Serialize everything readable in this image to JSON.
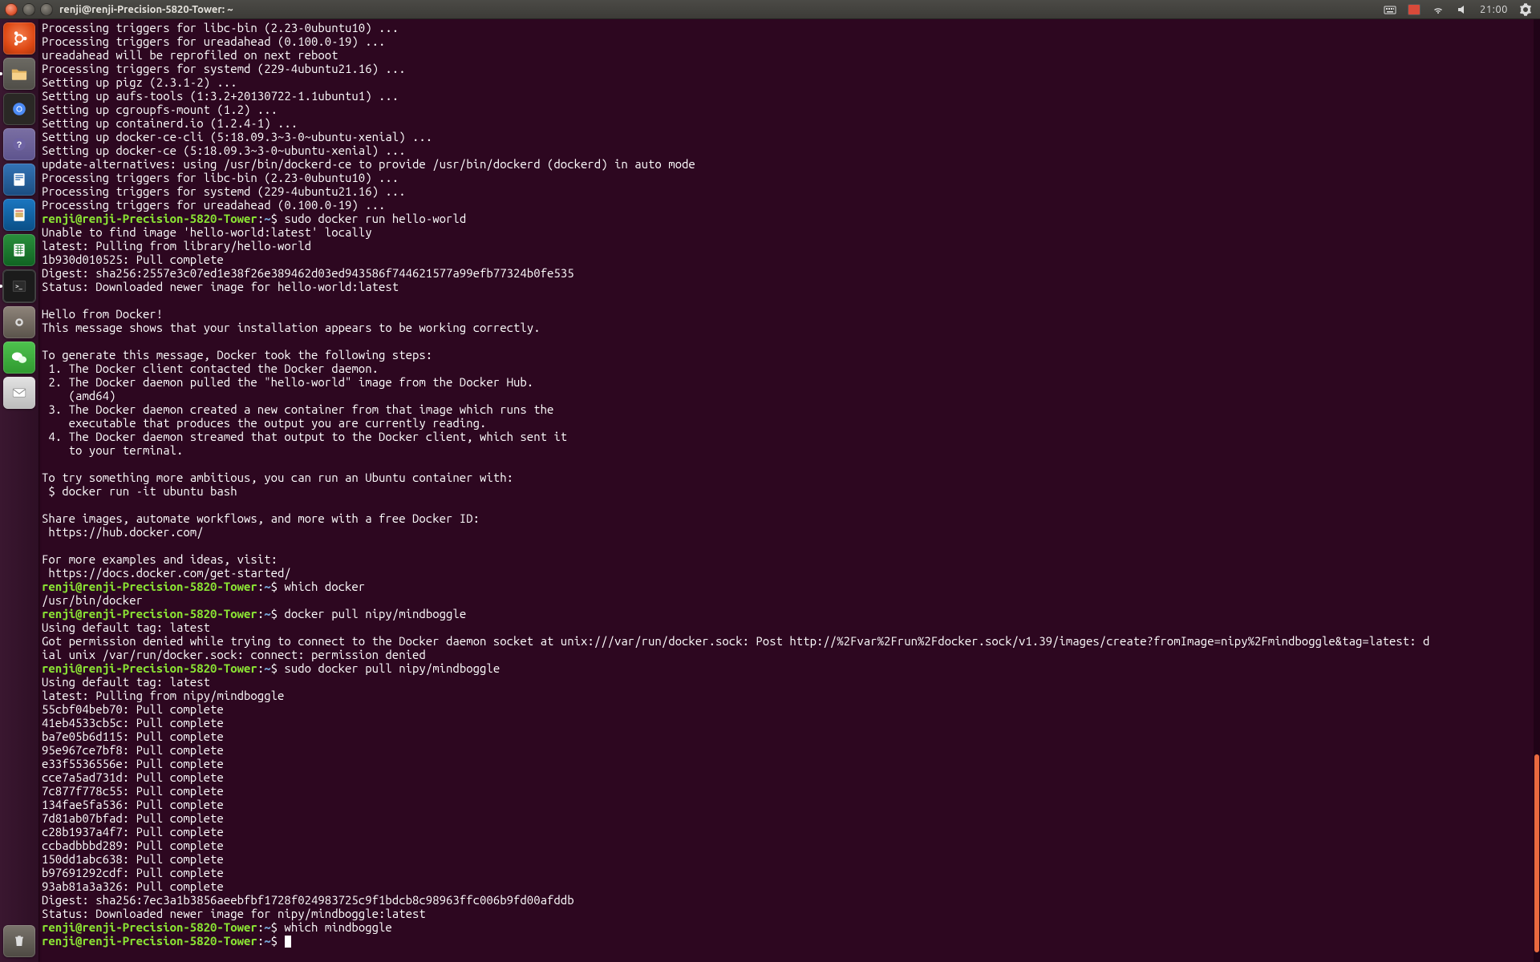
{
  "menubar": {
    "title": "renji@renji-Precision-5820-Tower: ~",
    "clock": "21:00"
  },
  "launcher": {
    "items": [
      {
        "name": "dash",
        "label": ""
      },
      {
        "name": "files",
        "label": ""
      },
      {
        "name": "chromium",
        "label": ""
      },
      {
        "name": "help",
        "label": "?"
      },
      {
        "name": "writer",
        "label": ""
      },
      {
        "name": "impress",
        "label": ""
      },
      {
        "name": "calc",
        "label": ""
      },
      {
        "name": "terminal",
        "label": ">_"
      },
      {
        "name": "settings",
        "label": ""
      },
      {
        "name": "wechat",
        "label": ""
      },
      {
        "name": "mail",
        "label": ""
      }
    ],
    "trash": {
      "name": "trash",
      "label": ""
    }
  },
  "prompt": {
    "user_host": "renji@renji-Precision-5820-Tower",
    "sep1": ":",
    "path": "~",
    "sep2": "$"
  },
  "cmds": {
    "c1": " sudo docker run hello-world",
    "c2": " which docker",
    "c3": " docker pull nipy/mindboggle",
    "c4": " sudo docker pull nipy/mindboggle",
    "c5": " which mindboggle",
    "c6": " "
  },
  "out": {
    "pre1": "Processing triggers for libc-bin (2.23-0ubuntu10) ...\nProcessing triggers for ureadahead (0.100.0-19) ...\nureadahead will be reprofiled on next reboot\nProcessing triggers for systemd (229-4ubuntu21.16) ...\nSetting up pigz (2.3.1-2) ...\nSetting up aufs-tools (1:3.2+20130722-1.1ubuntu1) ...\nSetting up cgroupfs-mount (1.2) ...\nSetting up containerd.io (1.2.4-1) ...\nSetting up docker-ce-cli (5:18.09.3~3-0~ubuntu-xenial) ...\nSetting up docker-ce (5:18.09.3~3-0~ubuntu-xenial) ...\nupdate-alternatives: using /usr/bin/dockerd-ce to provide /usr/bin/dockerd (dockerd) in auto mode\nProcessing triggers for libc-bin (2.23-0ubuntu10) ...\nProcessing triggers for systemd (229-4ubuntu21.16) ...\nProcessing triggers for ureadahead (0.100.0-19) ...",
    "o1": "Unable to find image 'hello-world:latest' locally\nlatest: Pulling from library/hello-world\n1b930d010525: Pull complete\nDigest: sha256:2557e3c07ed1e38f26e389462d03ed943586f744621577a99efb77324b0fe535\nStatus: Downloaded newer image for hello-world:latest\n\nHello from Docker!\nThis message shows that your installation appears to be working correctly.\n\nTo generate this message, Docker took the following steps:\n 1. The Docker client contacted the Docker daemon.\n 2. The Docker daemon pulled the \"hello-world\" image from the Docker Hub.\n    (amd64)\n 3. The Docker daemon created a new container from that image which runs the\n    executable that produces the output you are currently reading.\n 4. The Docker daemon streamed that output to the Docker client, which sent it\n    to your terminal.\n\nTo try something more ambitious, you can run an Ubuntu container with:\n $ docker run -it ubuntu bash\n\nShare images, automate workflows, and more with a free Docker ID:\n https://hub.docker.com/\n\nFor more examples and ideas, visit:\n https://docs.docker.com/get-started/\n",
    "o2": "/usr/bin/docker",
    "o3": "Using default tag: latest\nGot permission denied while trying to connect to the Docker daemon socket at unix:///var/run/docker.sock: Post http://%2Fvar%2Frun%2Fdocker.sock/v1.39/images/create?fromImage=nipy%2Fmindboggle&tag=latest: d\nial unix /var/run/docker.sock: connect: permission denied",
    "o4": "Using default tag: latest\nlatest: Pulling from nipy/mindboggle\n55cbf04beb70: Pull complete\n41eb4533cb5c: Pull complete\nba7e05b6d115: Pull complete\n95e967ce7bf8: Pull complete\ne33f5536556e: Pull complete\ncce7a5ad731d: Pull complete\n7c877f778c55: Pull complete\n134fae5fa536: Pull complete\n7d81ab07bfad: Pull complete\nc28b1937a4f7: Pull complete\nccbadbbbd289: Pull complete\n150dd1abc638: Pull complete\nb97691292cdf: Pull complete\n93ab81a3a326: Pull complete\nDigest: sha256:7ec3a1b3856aeebfbf1728f024983725c9f1bdcb8c98963ffc006b9fd00afddb\nStatus: Downloaded newer image for nipy/mindboggle:latest"
  },
  "scrollbar": {
    "thumb_top_pct": 78,
    "thumb_height_pct": 21
  }
}
